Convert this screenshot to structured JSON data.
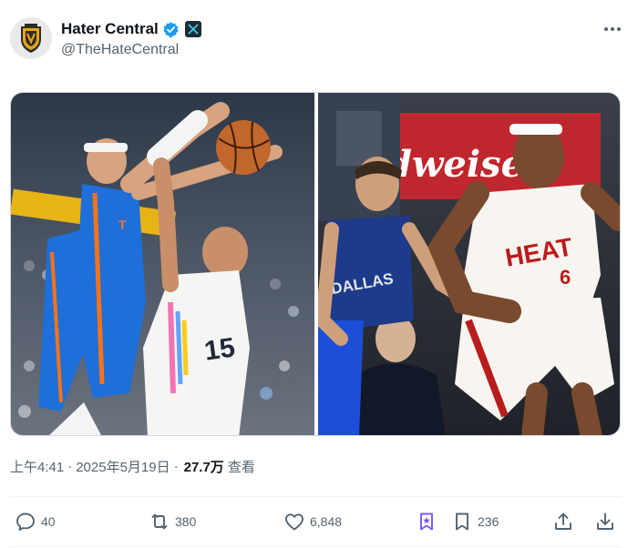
{
  "account": {
    "display_name": "Hater Central",
    "handle": "@TheHateCentral",
    "verified": true,
    "affiliate_badge": "x-logo-badge",
    "avatar_icon": "shield-logo-icon"
  },
  "menu": {
    "icon": "more-dots-icon"
  },
  "media": {
    "left_image": "basketball-block-photo",
    "right_image": "basketball-dribble-photo",
    "left_jersey_text": "15",
    "right_jersey_text": "HEAT",
    "right_jersey_number": "6",
    "left_defender_text": "DALLAS",
    "banner_text": "dweiser"
  },
  "meta": {
    "time": "上午4:41",
    "separator": "·",
    "date": "2025年5月19日",
    "views_count": "27.7万",
    "views_label": "查看"
  },
  "actions": {
    "reply_count": "40",
    "repost_count": "380",
    "like_count": "6,848",
    "bookmark_count": "236"
  },
  "colors": {
    "text_primary": "#0f1419",
    "text_secondary": "#536471",
    "verified_blue": "#1d9bf0",
    "bookmark_purple": "#7856ff"
  }
}
